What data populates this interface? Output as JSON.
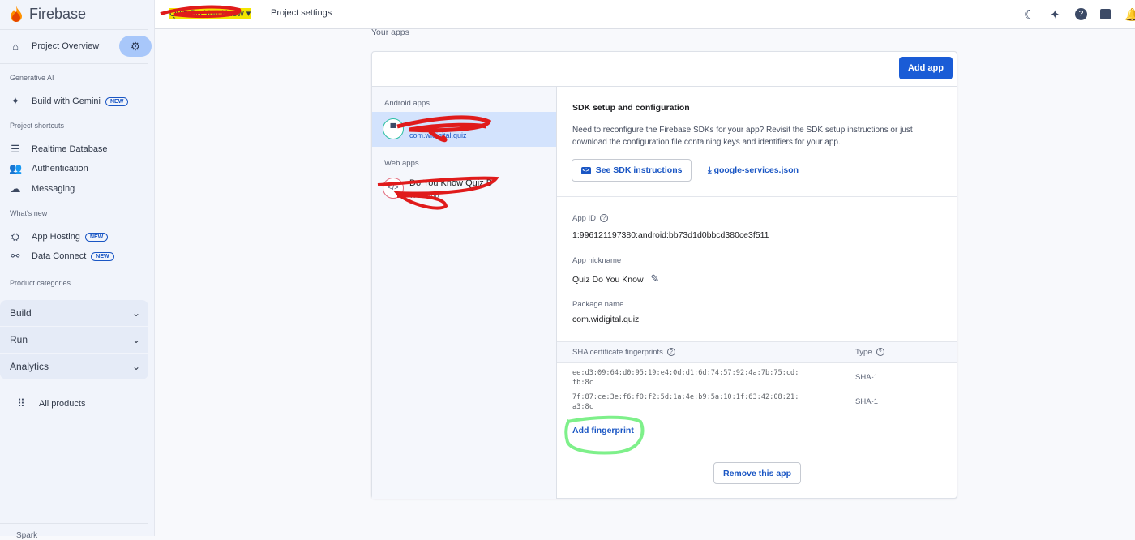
{
  "brand": {
    "name": "Firebase"
  },
  "topbar": {
    "project_name": "Quiz Do You Know",
    "page_title": "Project settings",
    "icons": [
      "dark-mode-icon",
      "gemini-icon",
      "help-icon",
      "notes-icon",
      "notifications-icon"
    ]
  },
  "sidebar": {
    "overview": "Project Overview",
    "sections": [
      {
        "label": "Generative AI",
        "items": [
          {
            "label": "Build with Gemini",
            "badge": "NEW",
            "icon": "sparkle-icon"
          }
        ]
      },
      {
        "label": "Project shortcuts",
        "items": [
          {
            "label": "Realtime Database",
            "icon": "database-icon"
          },
          {
            "label": "Authentication",
            "icon": "people-icon"
          },
          {
            "label": "Messaging",
            "icon": "cloud-icon"
          }
        ]
      },
      {
        "label": "What's new",
        "items": [
          {
            "label": "App Hosting",
            "badge": "NEW",
            "icon": "hosting-icon"
          },
          {
            "label": "Data Connect",
            "badge": "NEW",
            "icon": "data-connect-icon"
          }
        ]
      },
      {
        "label": "Product categories",
        "items": []
      }
    ],
    "groups": [
      "Build",
      "Run",
      "Analytics"
    ],
    "all_products": "All products",
    "footer": "Spark"
  },
  "main": {
    "section_title": "Your apps",
    "add_app": "Add app",
    "android_header": "Android apps",
    "android_app": {
      "package": "com.widigital.quiz"
    },
    "web_header": "Web apps",
    "web_app": {
      "name": "Do You Know Quiz B",
      "type": "Web App"
    },
    "sdk": {
      "title": "SDK setup and configuration",
      "description": "Need to reconfigure the Firebase SDKs for your app? Revisit the SDK setup instructions or just download the configuration file containing keys and identifiers for your app.",
      "instructions_button": "See SDK instructions",
      "download_link": "google-services.json"
    },
    "app_id": {
      "label": "App ID",
      "value": "1:996121197380:android:bb73d1d0bbcd380ce3f511"
    },
    "nickname": {
      "label": "App nickname",
      "value": "Quiz Do You Know"
    },
    "package": {
      "label": "Package name",
      "value": "com.widigital.quiz"
    },
    "fingerprints": {
      "col_fingerprint": "SHA certificate fingerprints",
      "col_type": "Type",
      "rows": [
        {
          "line1": "ee:d3:09:64:d0:95:19:e4:0d:d1:6d:74:57:92:4a:7b:75:cd:",
          "line2": "fb:8c",
          "type": "SHA-1"
        },
        {
          "line1": "7f:87:ce:3e:f6:f0:f2:5d:1a:4e:b9:5a:10:1f:63:42:08:21:",
          "line2": "a3:8c",
          "type": "SHA-1"
        }
      ],
      "add": "Add fingerprint"
    },
    "remove": "Remove this app"
  },
  "colors": {
    "accent": "#1a5cd6",
    "sidebar_bg": "#f1f4fb",
    "selected_row": "#d3e3fd",
    "scribble": "#e01b1b",
    "highlight_circle": "#7ef08a"
  }
}
